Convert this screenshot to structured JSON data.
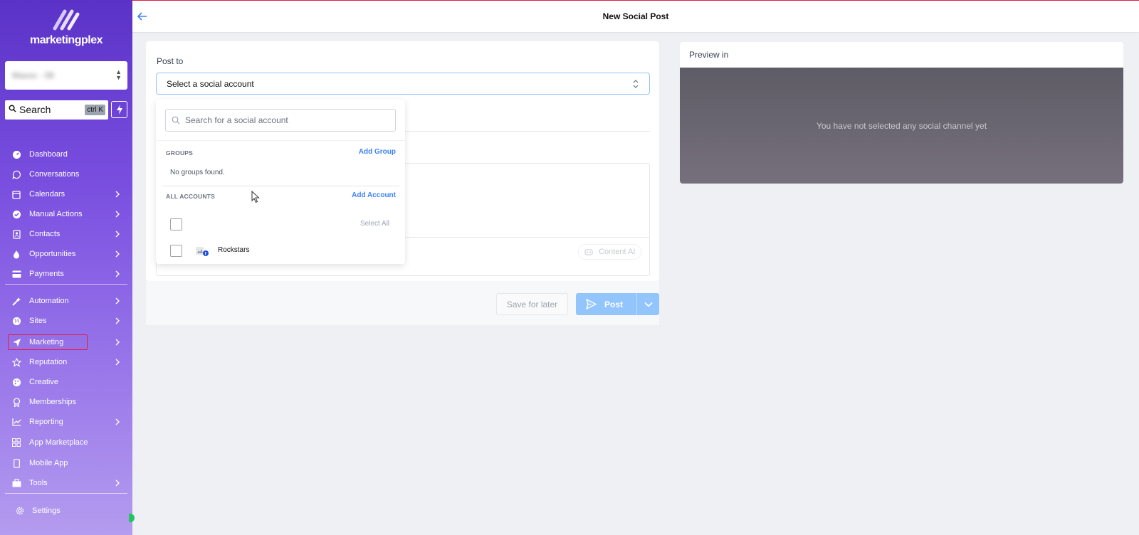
{
  "brand": {
    "name": "marketingplex"
  },
  "location_select": {
    "value": "blurred location"
  },
  "search": {
    "label": "Search",
    "shortcut": "ctrl K"
  },
  "nav": {
    "items": [
      {
        "label": "Dashboard",
        "icon": "dashboard-icon",
        "has_submenu": false
      },
      {
        "label": "Conversations",
        "icon": "chat-icon",
        "has_submenu": false
      },
      {
        "label": "Calendars",
        "icon": "calendar-icon",
        "has_submenu": true
      },
      {
        "label": "Manual Actions",
        "icon": "check-circle-icon",
        "has_submenu": true
      },
      {
        "label": "Contacts",
        "icon": "contact-book-icon",
        "has_submenu": true
      },
      {
        "label": "Opportunities",
        "icon": "flame-icon",
        "has_submenu": true
      },
      {
        "label": "Payments",
        "icon": "credit-card-icon",
        "has_submenu": true
      },
      {
        "label": "Automation",
        "icon": "magic-wand-icon",
        "has_submenu": true
      },
      {
        "label": "Sites",
        "icon": "globe-icon",
        "has_submenu": true
      },
      {
        "label": "Marketing",
        "icon": "paper-plane-icon",
        "has_submenu": true,
        "highlighted": true
      },
      {
        "label": "Reputation",
        "icon": "star-icon",
        "has_submenu": true
      },
      {
        "label": "Creative",
        "icon": "palette-icon",
        "has_submenu": false
      },
      {
        "label": "Memberships",
        "icon": "badge-icon",
        "has_submenu": false
      },
      {
        "label": "Reporting",
        "icon": "chart-icon",
        "has_submenu": true
      },
      {
        "label": "App Marketplace",
        "icon": "grid-icon",
        "has_submenu": false
      },
      {
        "label": "Mobile App",
        "icon": "phone-icon",
        "has_submenu": false
      },
      {
        "label": "Tools",
        "icon": "toolbox-icon",
        "has_submenu": true
      }
    ],
    "settings_label": "Settings"
  },
  "header": {
    "title": "New Social Post"
  },
  "post": {
    "post_to_label": "Post to",
    "account_placeholder": "Select a social account",
    "content_ai_label": "Content AI",
    "save_later_label": "Save for later",
    "post_label": "Post"
  },
  "dropdown": {
    "search_placeholder": "Search for a social account",
    "groups_heading": "GROUPS",
    "add_group_label": "Add Group",
    "no_groups_text": "No groups found.",
    "all_accounts_heading": "ALL ACCOUNTS",
    "add_account_label": "Add Account",
    "select_all_label": "Select All",
    "accounts": [
      {
        "name": "Rockstars",
        "platform": "facebook"
      }
    ]
  },
  "preview": {
    "label": "Preview in",
    "empty_message": "You have not selected any social channel yet"
  },
  "colors": {
    "sidebar_top": "#5b32c7",
    "sidebar_bottom": "#b49cef",
    "accent_blue": "#3b82f6",
    "post_button": "#93c5fd",
    "highlight_border": "#e11d48"
  }
}
